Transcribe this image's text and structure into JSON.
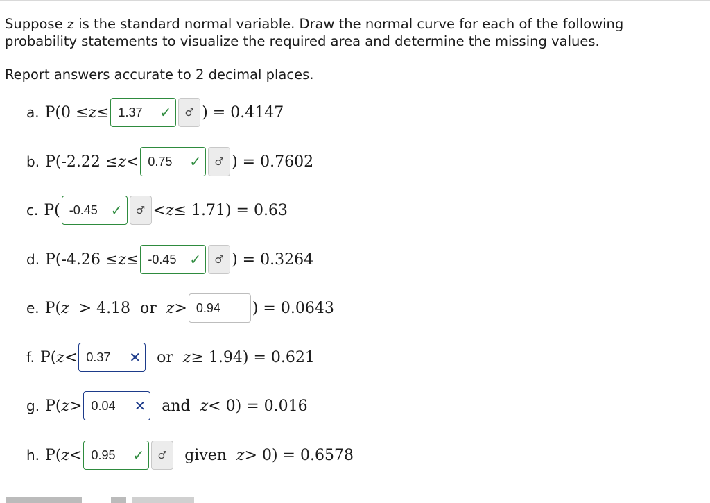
{
  "intro": "Suppose z is the standard normal variable. Draw the normal curve for each of the following probability statements to visualize the required area and determine the missing values.",
  "intro_pre": "Suppose ",
  "intro_var": "z",
  "intro_post": " is the standard normal variable. Draw the normal curve for each of the following probability statements to visualize the required area and determine the missing values.",
  "report": "Report answers accurate to 2 decimal places.",
  "key_icon": "♂",
  "check_icon": "✓",
  "wrong_icon": "✕",
  "colors": {
    "correct": "#2e8b3e",
    "incorrect": "#1d3b8a"
  },
  "rows": {
    "a": {
      "label": "a.",
      "pre": "P(0 ≤ ",
      "z": "z",
      "mid": " ≤ ",
      "answer": "1.37",
      "status": "correct",
      "post": ") = 0.4147"
    },
    "b": {
      "label": "b.",
      "pre": "P(-2.22 ≤ ",
      "z": "z",
      "mid": " < ",
      "answer": "0.75",
      "status": "correct",
      "post": ") = 0.7602"
    },
    "c": {
      "label": "c.",
      "pre": "P(",
      "answer": "-0.45",
      "status": "correct",
      "mid": " < ",
      "z": "z",
      "post": " ≤ 1.71) = 0.63"
    },
    "d": {
      "label": "d.",
      "pre": "P(-4.26 ≤ ",
      "z": "z",
      "mid": " ≤ ",
      "answer": "-0.45",
      "status": "correct",
      "post": ") = 0.3264"
    },
    "e": {
      "label": "e.",
      "pre": "P(",
      "z": "z",
      "mid": "  > 4.18  or  ",
      "z2": "z",
      "mid2": " > ",
      "answer": "0.94",
      "status": "none",
      "post": ") = 0.0643"
    },
    "f": {
      "label": "f.",
      "pre": "P(",
      "z": "z",
      "mid": " < ",
      "answer": "0.37",
      "status": "incorrect",
      "mid2": "  or  ",
      "z2": "z",
      "post": " ≥ 1.94) = 0.621"
    },
    "g": {
      "label": "g.",
      "pre": "P(",
      "z": "z",
      "mid": " > ",
      "answer": "0.04",
      "status": "incorrect",
      "mid2": "  and  ",
      "z2": "z",
      "post": " < 0) = 0.016"
    },
    "h": {
      "label": "h.",
      "pre": "P(",
      "z": "z",
      "mid": " < ",
      "answer": "0.95",
      "status": "correct",
      "mid2": "  given  ",
      "z2": "z",
      "post": " > 0) = 0.6578"
    }
  }
}
